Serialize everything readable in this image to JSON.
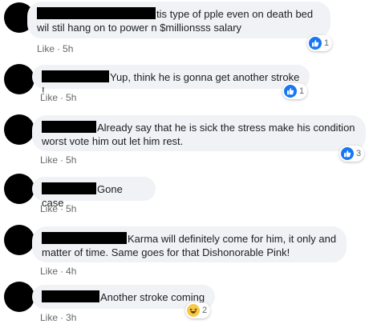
{
  "colors": {
    "like_blue": "#1877f2",
    "bubble_bg": "#f0f2f5",
    "meta_grey": "#65676b",
    "redaction": "#000000"
  },
  "comments": [
    {
      "text": "tis type of pple even on death bed wil stil hang on to power n $millionsss salary",
      "like_label": "Like",
      "time": "5h",
      "reaction_icon": "like-icon",
      "reaction_count": "1"
    },
    {
      "text": "Yup, think he is gonna get another stroke !",
      "like_label": "Like",
      "time": "5h",
      "reaction_icon": "like-icon",
      "reaction_count": "1"
    },
    {
      "text": "Already say that he is sick the stress make his condition worst vote him out let him rest.",
      "like_label": "Like",
      "time": "5h",
      "reaction_icon": "like-icon",
      "reaction_count": "3"
    },
    {
      "text": "Gone case",
      "like_label": "Like",
      "time": "5h"
    },
    {
      "text": "Karma will definitely come for him, it only and matter of time. Same goes for that Dishonorable Pink!",
      "like_label": "Like",
      "time": "4h"
    },
    {
      "text": "Another stroke coming",
      "like_label": "Like",
      "time": "3h",
      "reaction_icon": "haha-icon",
      "reaction_count": "2"
    }
  ]
}
